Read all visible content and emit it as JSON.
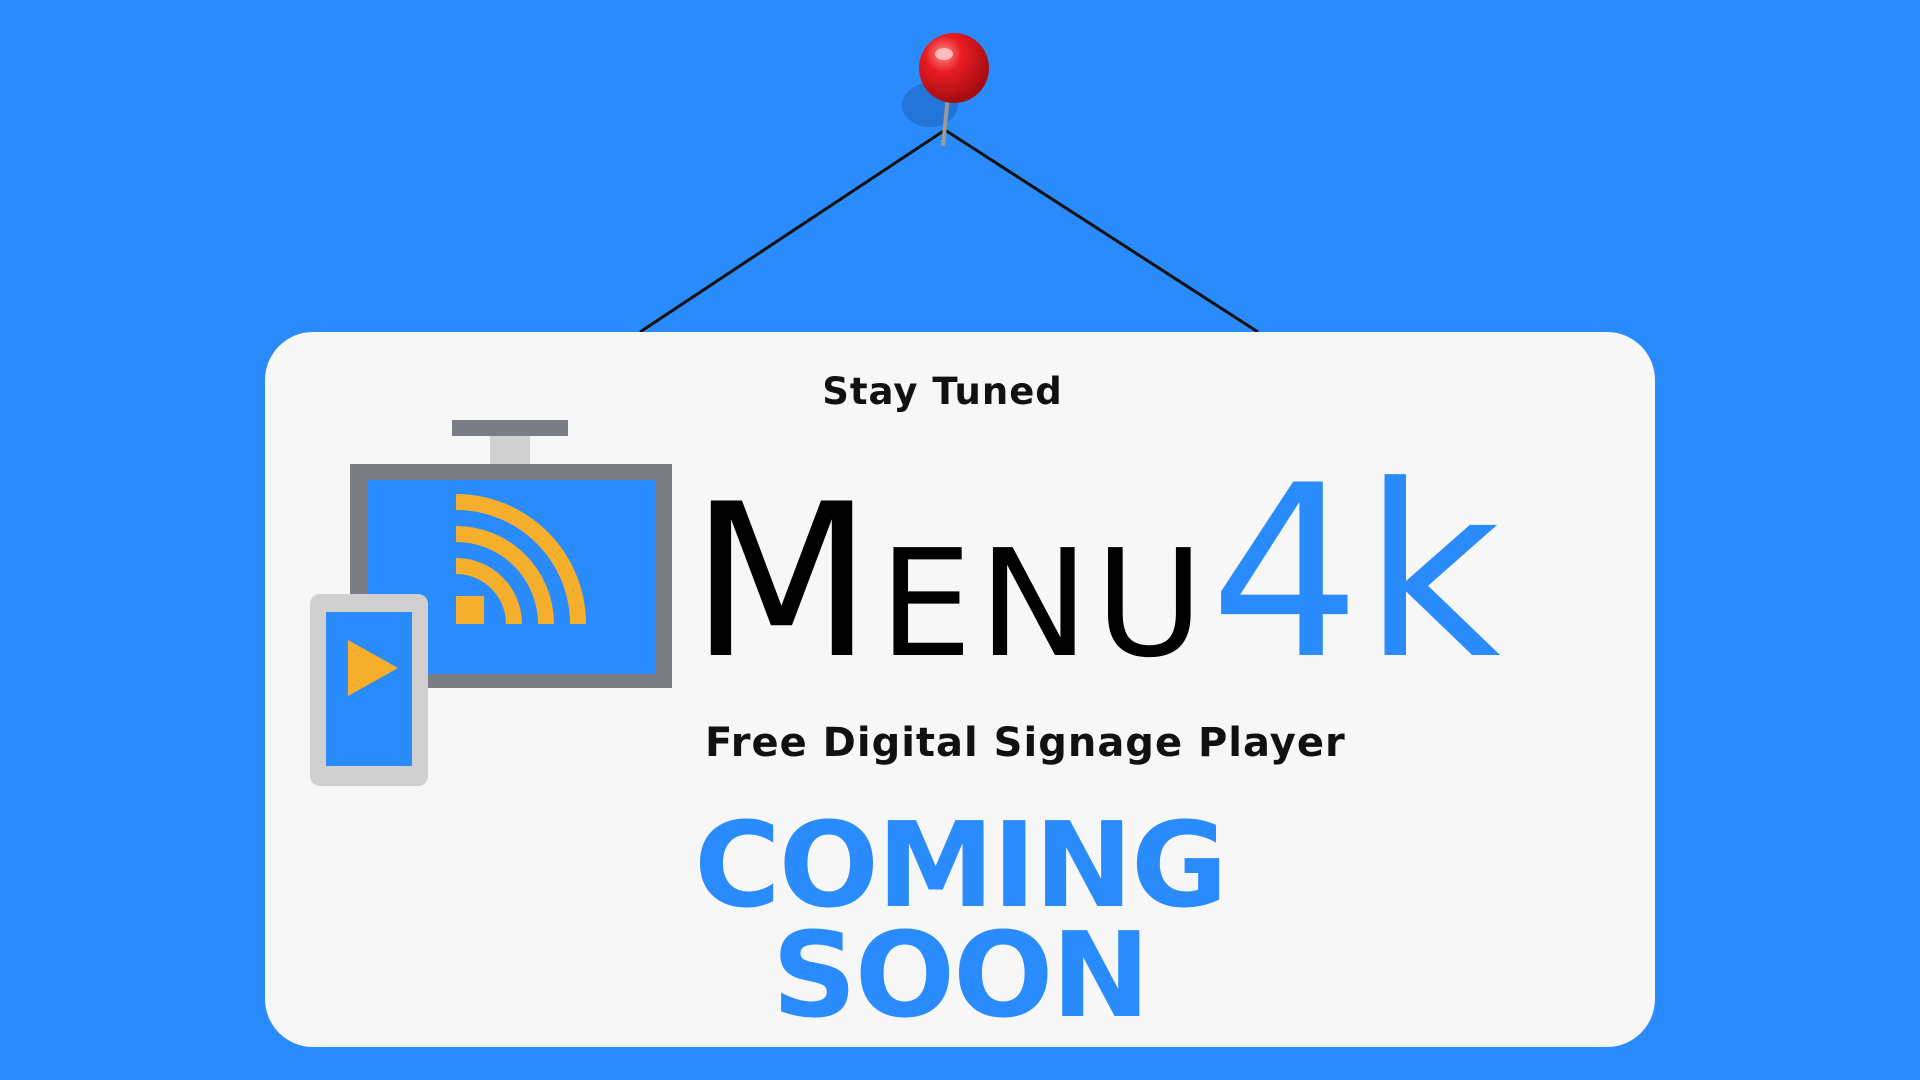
{
  "sign": {
    "headline": "Stay Tuned",
    "brand_name_part1": "Menu",
    "brand_name_part2": "4k",
    "tagline": "Free Digital Signage Player",
    "coming_line1": "COMING",
    "coming_line2": "SOON"
  },
  "icons": {
    "pin": "red-pushpin-icon",
    "logo": "tv-cast-phone-play-icon"
  },
  "colors": {
    "background": "#2a8bfc",
    "board": "#f7f7f7",
    "accent_blue": "#2a8bfc",
    "pin_red": "#e0141c",
    "wifi_orange": "#f6ae2d",
    "frame_grey": "#7b7d85"
  }
}
